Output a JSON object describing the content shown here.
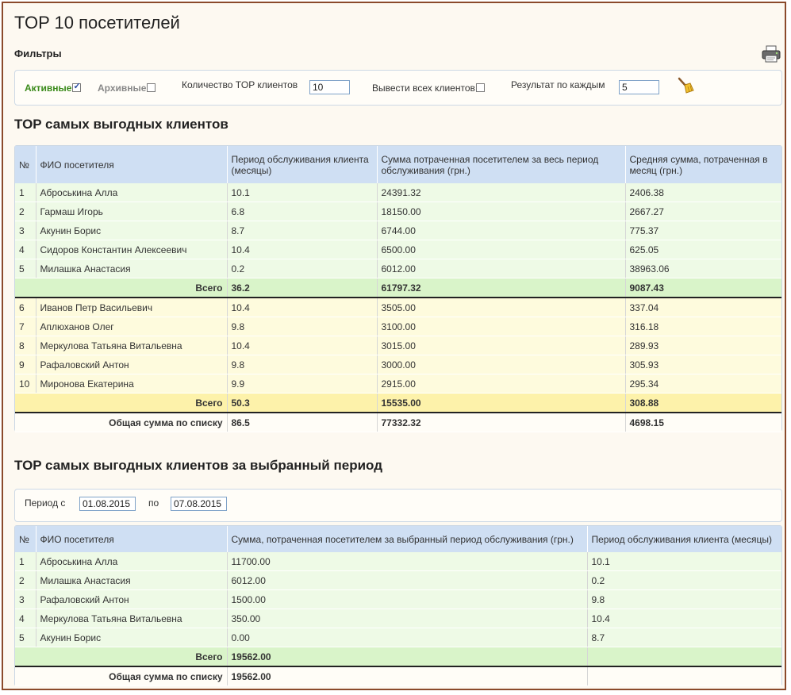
{
  "page_title": "TOP 10 посетителей",
  "filters": {
    "label": "Фильтры",
    "active_label": "Активные",
    "active_checked": true,
    "archive_label": "Архивные",
    "archive_checked": false,
    "top_count_label": "Количество TOP клиентов",
    "top_count_value": "10",
    "show_all_label": "Вывести всех клиентов",
    "show_all_checked": false,
    "per_result_label": "Результат по каждым",
    "per_result_value": "5"
  },
  "icons": {
    "print": "printer-icon",
    "clear": "broom-icon"
  },
  "section1": {
    "title": "TOP самых выгодных клиентов",
    "headers": [
      "№",
      "ФИО посетителя",
      "Период обслуживания клиента (месяцы)",
      "Сумма потраченная посетителем за весь период обслуживания (грн.)",
      "Средняя сумма, потраченная в месяц (грн.)"
    ],
    "group1": [
      [
        "1",
        "Аброськина Алла",
        "10.1",
        "24391.32",
        "2406.38"
      ],
      [
        "2",
        "Гармаш Игорь",
        "6.8",
        "18150.00",
        "2667.27"
      ],
      [
        "3",
        "Акунин Борис",
        "8.7",
        "6744.00",
        "775.37"
      ],
      [
        "4",
        "Сидоров Константин Алексеевич",
        "10.4",
        "6500.00",
        "625.05"
      ],
      [
        "5",
        "Милашка Анастасия",
        "0.2",
        "6012.00",
        "38963.06"
      ]
    ],
    "group1_total": {
      "label": "Всего",
      "period": "36.2",
      "sum": "61797.32",
      "avg": "9087.43"
    },
    "group2": [
      [
        "6",
        "Иванов Петр Васильевич",
        "10.4",
        "3505.00",
        "337.04"
      ],
      [
        "7",
        "Аплюханов Олег",
        "9.8",
        "3100.00",
        "316.18"
      ],
      [
        "8",
        "Меркулова Татьяна Витальевна",
        "10.4",
        "3015.00",
        "289.93"
      ],
      [
        "9",
        "Рафаловский Антон",
        "9.8",
        "3000.00",
        "305.93"
      ],
      [
        "10",
        "Миронова Екатерина",
        "9.9",
        "2915.00",
        "295.34"
      ]
    ],
    "group2_total": {
      "label": "Всего",
      "period": "50.3",
      "sum": "15535.00",
      "avg": "308.88"
    },
    "grand_total": {
      "label": "Общая сумма по списку",
      "period": "86.5",
      "sum": "77332.32",
      "avg": "4698.15"
    }
  },
  "section2": {
    "title": "TOP самых выгодных клиентов за выбранный период",
    "period_from_label": "Период с",
    "period_from_value": "01.08.2015",
    "period_to_label": "по",
    "period_to_value": "07.08.2015",
    "headers": [
      "№",
      "ФИО посетителя",
      "Сумма, потраченная посетителем за выбранный период обслуживания (грн.)",
      "Период обслуживания клиента (месяцы)"
    ],
    "rows": [
      [
        "1",
        "Аброськина Алла",
        "11700.00",
        "10.1"
      ],
      [
        "2",
        "Милашка Анастасия",
        "6012.00",
        "0.2"
      ],
      [
        "3",
        "Рафаловский Антон",
        "1500.00",
        "9.8"
      ],
      [
        "4",
        "Меркулова Татьяна Витальевна",
        "350.00",
        "10.4"
      ],
      [
        "5",
        "Акунин Борис",
        "0.00",
        "8.7"
      ]
    ],
    "group_total": {
      "label": "Всего",
      "sum": "19562.00",
      "period": ""
    },
    "grand_total": {
      "label": "Общая сумма по списку",
      "sum": "19562.00",
      "period": ""
    }
  }
}
